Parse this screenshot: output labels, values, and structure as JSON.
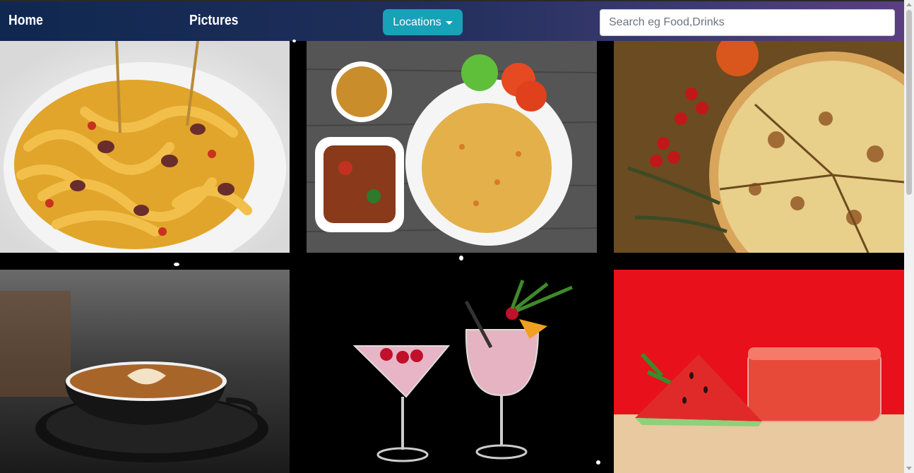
{
  "nav": {
    "home": "Home",
    "pictures": "Pictures",
    "locations_button": "Locations",
    "search_placeholder": "Search eg Food,Drinks"
  },
  "gallery": {
    "images": [
      {
        "subject": "pasta"
      },
      {
        "subject": "fried-rice-plate"
      },
      {
        "subject": "pizza"
      },
      {
        "subject": "latte-coffee"
      },
      {
        "subject": "cocktails"
      },
      {
        "subject": "watermelon-juice"
      }
    ]
  },
  "colors": {
    "navbar_start": "#0f2850",
    "navbar_end": "#5b3f80",
    "accent_button": "#17a2b8",
    "page_background": "#000000"
  }
}
